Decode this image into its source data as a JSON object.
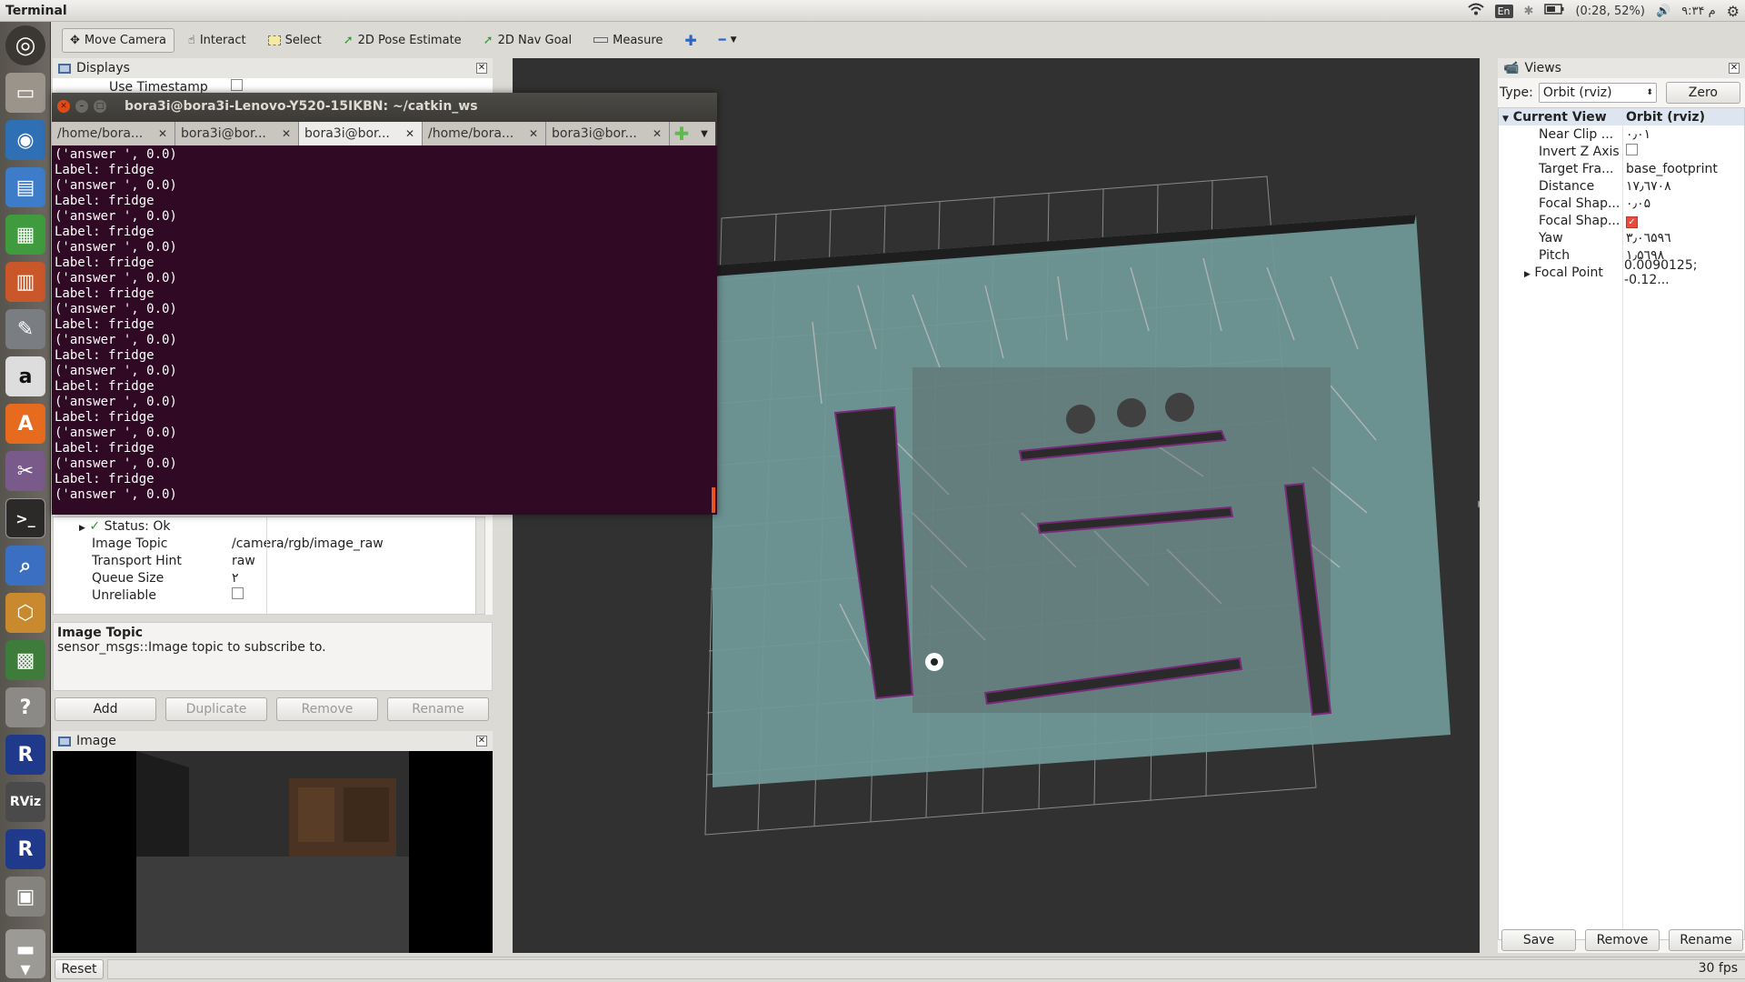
{
  "topbar": {
    "app_title": "Terminal",
    "keyboard_layout": "En",
    "battery": "(0:28, 52%)",
    "clock": "۹:۳۴ م"
  },
  "toolbar": {
    "move_camera": "Move Camera",
    "interact": "Interact",
    "select": "Select",
    "pose_estimate": "2D Pose Estimate",
    "nav_goal": "2D Nav Goal",
    "measure": "Measure"
  },
  "displays": {
    "title": "Displays",
    "use_timestamp": "Use Timestamp",
    "status": "Status: Ok",
    "props": [
      {
        "key": "Image Topic",
        "value": "/camera/rgb/image_raw"
      },
      {
        "key": "Transport Hint",
        "value": "raw"
      },
      {
        "key": "Queue Size",
        "value": "۲"
      },
      {
        "key": "Unreliable",
        "value": ""
      }
    ],
    "desc_title": "Image Topic",
    "desc_text": "sensor_msgs::Image topic to subscribe to.",
    "buttons": {
      "add": "Add",
      "duplicate": "Duplicate",
      "remove": "Remove",
      "rename": "Rename"
    }
  },
  "image_panel": {
    "title": "Image"
  },
  "terminal": {
    "title": "bora3i@bora3i-Lenovo-Y520-15IKBN: ~/catkin_ws",
    "tabs": [
      "/home/bora...",
      "bora3i@bor...",
      "bora3i@bor...",
      "/home/bora...",
      "bora3i@bor..."
    ],
    "lines": [
      "('answer ', 0.0)",
      "Label: fridge",
      "('answer ', 0.0)",
      "Label: fridge",
      "('answer ', 0.0)",
      "Label: fridge",
      "('answer ', 0.0)",
      "Label: fridge",
      "('answer ', 0.0)",
      "Label: fridge",
      "('answer ', 0.0)",
      "Label: fridge",
      "('answer ', 0.0)",
      "Label: fridge",
      "('answer ', 0.0)",
      "Label: fridge",
      "('answer ', 0.0)",
      "Label: fridge",
      "('answer ', 0.0)",
      "Label: fridge",
      "('answer ', 0.0)",
      "Label: fridge",
      "('answer ', 0.0)",
      "Label: fridge",
      "('answer ', 0.0)",
      "Label: fridge",
      "('answer ', 0.0)",
      "Label: fridge",
      "('answer ', 0.0)",
      "Label: fridge",
      "('answer ', 0.0)",
      "Label: fridge",
      "('answer ', 0.0)",
      "Label: fridge",
      "('answer ', 0.0)",
      "Label: fridge",
      "('answer ', 0.0)",
      "Label: fridge",
      "('answer ', 0.0)",
      "Label: fridge",
      "('answer ', 0.0)",
      "Label: fridge",
      "('answer ', 0.0)",
      "Label: fridge",
      "('answer ', 0.0)",
      "Label: fridge",
      "('answer ', 0.0)",
      "Label: fridge",
      "('answer ', 0.0)",
      "Label: fridge",
      "('answer ', 0.0)",
      "Label: fridge",
      "('answer ', 0.0)",
      "Label: fridge",
      "('answer ', 0.0)",
      "Label: fridge",
      "('answer ', 0.0)",
      "Label: fridge",
      "('answer ', 0.0)"
    ]
  },
  "views": {
    "title": "Views",
    "type_label": "Type:",
    "type_value": "Orbit (rviz)",
    "zero": "Zero",
    "current_view": "Current View",
    "current_view_type": "Orbit (rviz)",
    "props": [
      {
        "key": "Near Clip ...",
        "value": "۰٫۰۱"
      },
      {
        "key": "Invert Z Axis",
        "value": ""
      },
      {
        "key": "Target Fra...",
        "value": "base_footprint"
      },
      {
        "key": "Distance",
        "value": "۱۷٫٦۷۰۸"
      },
      {
        "key": "Focal Shap...",
        "value": "۰٫۰۵"
      },
      {
        "key": "Focal Shap...",
        "value": ""
      },
      {
        "key": "Yaw",
        "value": "۳٫۰٦۵۹٦"
      },
      {
        "key": "Pitch",
        "value": "۱٫۵٦۹۸"
      },
      {
        "key": "Focal Point",
        "value": "0.0090125; -0.12..."
      }
    ],
    "buttons": {
      "save": "Save",
      "remove": "Remove",
      "rename": "Rename"
    }
  },
  "statusbar": {
    "reset": "Reset",
    "fps": "30 fps"
  }
}
